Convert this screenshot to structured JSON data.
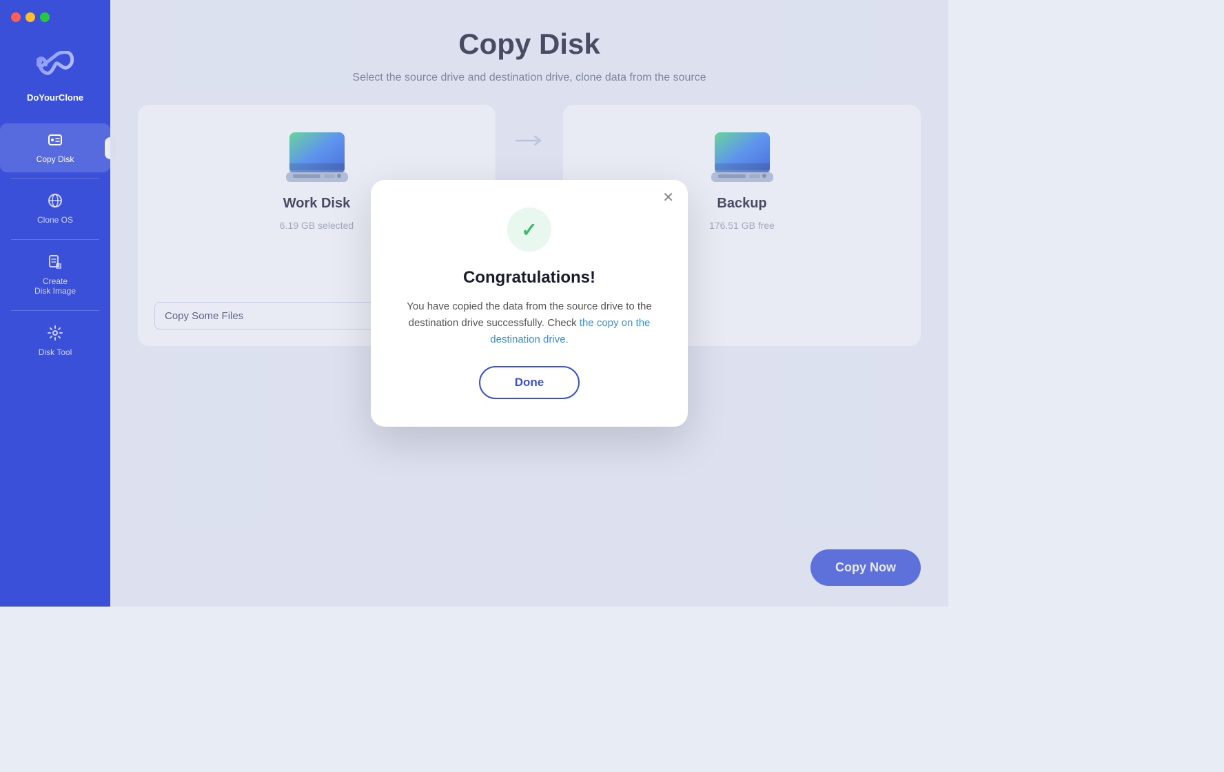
{
  "app": {
    "name": "DoYourClone",
    "title": "Copy Disk",
    "subtitle": "Select the source drive and destination drive, clone data from the source"
  },
  "trafficLights": {
    "red": "close",
    "yellow": "minimize",
    "green": "maximize"
  },
  "sidebar": {
    "items": [
      {
        "id": "copy-disk",
        "label": "Copy Disk",
        "icon": "⊡",
        "active": true
      },
      {
        "id": "clone-os",
        "label": "Clone OS",
        "icon": "⊙",
        "active": false
      },
      {
        "id": "create-disk-image",
        "label": "Create\nDisk Image",
        "icon": "🖻",
        "active": false
      },
      {
        "id": "disk-tool",
        "label": "Disk Tool",
        "icon": "⚙",
        "active": false
      }
    ]
  },
  "cards": {
    "source": {
      "name": "Work Disk",
      "info": "6.19 GB selected"
    },
    "destination": {
      "name": "Backup",
      "info": "176.51 GB free"
    }
  },
  "copyMode": {
    "label": "Copy Some Files",
    "placeholder": "Copy Some Files"
  },
  "buttons": {
    "copyNow": "Copy Now",
    "done": "Done"
  },
  "modal": {
    "title": "Congratulations!",
    "body": "You have copied the data from the source drive to the destination drive successfully. Check ",
    "linkText": "the copy on the destination drive.",
    "checkIcon": "✓"
  },
  "icons": {
    "search": "🔍",
    "dropdown": "▾",
    "close": "✕",
    "arrow": "→"
  }
}
